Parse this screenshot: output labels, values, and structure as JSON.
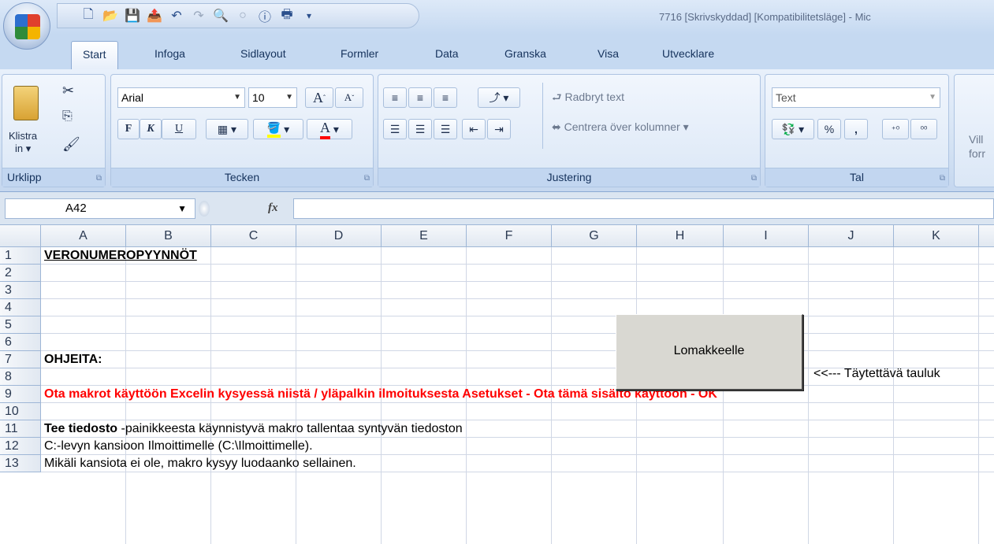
{
  "title": "7716  [Skrivskyddad]  [Kompatibilitetsläge] - Mic",
  "tabs": [
    "Start",
    "Infoga",
    "Sidlayout",
    "Formler",
    "Data",
    "Granska",
    "Visa",
    "Utvecklare"
  ],
  "ribbon": {
    "clipboard": {
      "paste_label": "Klistra",
      "paste_label2": "in ▾",
      "group_label": "Urklipp"
    },
    "font": {
      "font_name": "Arial",
      "font_size": "10",
      "bold": "F",
      "italic": "K",
      "underline": "U",
      "group_label": "Tecken"
    },
    "alignment": {
      "wrap_text": "Radbryt text",
      "merge_center": "Centrera över kolumner",
      "group_label": "Justering"
    },
    "number": {
      "format": "Text",
      "percent": "%",
      "comma": ",",
      "group_label": "Tal"
    },
    "styles": {
      "cond_format_1": "Vill",
      "cond_format_2": "forr"
    }
  },
  "formula_bar": {
    "name_box": "A42",
    "fx": "fx",
    "formula": ""
  },
  "columns": [
    "A",
    "B",
    "C",
    "D",
    "E",
    "F",
    "G",
    "H",
    "I",
    "J",
    "K"
  ],
  "rows": [
    "1",
    "2",
    "3",
    "4",
    "5",
    "6",
    "7",
    "8",
    "9",
    "10",
    "11",
    "12",
    "13"
  ],
  "cells": {
    "r1": "VERONUMEROPYYNNÖT",
    "r7": "OHJEITA:",
    "r9": "Ota makrot käyttöön Excelin kysyessä niistä / yläpalkin ilmoituksesta Asetukset - Ota tämä sisältö käyttöön - OK",
    "r11_bold": "Tee tiedosto",
    "r11_rest": " -painikkeesta käynnistyvä makro tallentaa syntyvän tiedoston",
    "r12": "C:-levyn kansioon Ilmoittimelle (C:\\Ilmoittimelle).",
    "r13": "Mikäli kansiota ei ole, makro kysyy luodaanko sellainen."
  },
  "form_button": "Lomakkeelle",
  "hint_text": "<<--- Täytettävä tauluk",
  "colors": {
    "ribbon_bg": "#d5e3f4",
    "instruction_red": "#ff0000",
    "header_border": "#9eb6d6"
  }
}
